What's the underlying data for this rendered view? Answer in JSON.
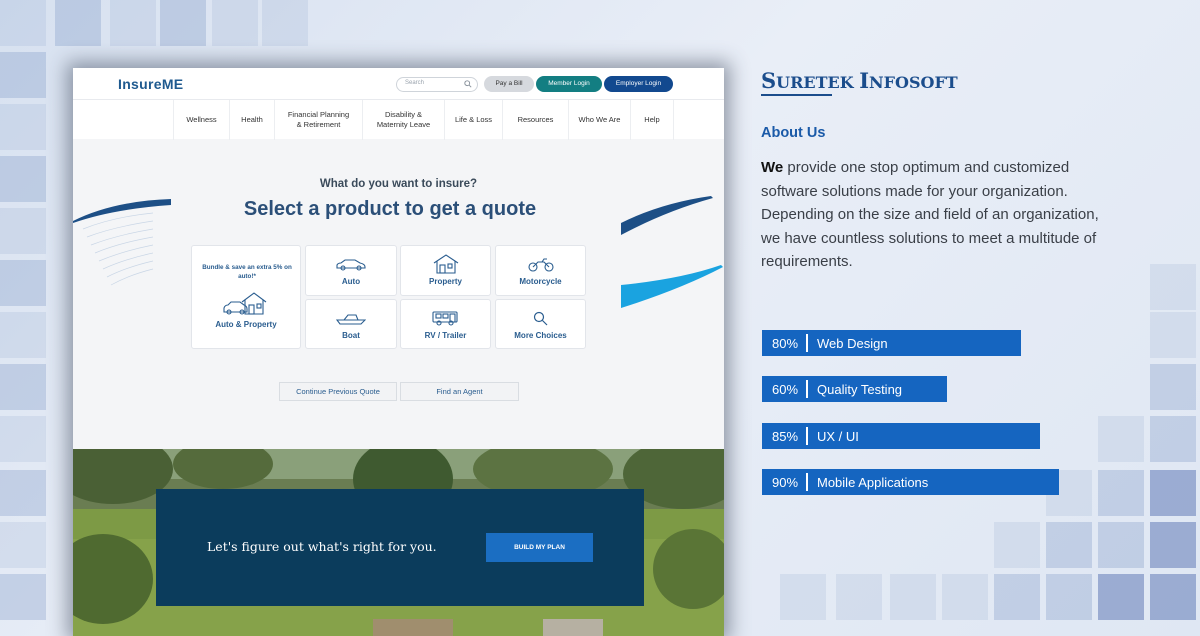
{
  "mockup": {
    "logo": "InsureME",
    "search_placeholder": "Search",
    "pay_bill": "Pay a Bill",
    "member_login": "Member Login",
    "employer_login": "Employer Login",
    "nav": [
      "Wellness",
      "Health",
      "Financial Planning\n& Retirement",
      "Disability &\nMaternity Leave",
      "Life & Loss",
      "Resources",
      "Who We Are",
      "Help"
    ],
    "question": "What do you want to insure?",
    "headline": "Select a product to get a quote",
    "bundle_text": "Bundle & save an extra 5% on auto!*",
    "products": {
      "auto_property": "Auto & Property",
      "auto": "Auto",
      "property": "Property",
      "motorcycle": "Motorcycle",
      "boat": "Boat",
      "rv": "RV / Trailer",
      "more": "More Choices"
    },
    "continue_quote": "Continue Previous Quote",
    "find_agent": "Find an Agent",
    "cta_text": "Let's figure out what's right for you.",
    "cta_button": "BUILD MY PLAN"
  },
  "panel": {
    "brand_first": "S",
    "brand_rest1": "URETEK ",
    "brand_i": "I",
    "brand_rest2": "NFOSOFT",
    "about_heading": "About Us",
    "about_first_word": "We",
    "about_body": " provide one stop optimum and customized software solutions made for your organization. Depending on the size and field of an organization, we have countless solutions to meet a multitude of requirements.",
    "skills": [
      {
        "percent": "80%",
        "label": "Web Design",
        "value": 80
      },
      {
        "percent": "60%",
        "label": "Quality Testing",
        "value": 60
      },
      {
        "percent": "85%",
        "label": "UX / UI",
        "value": 85
      },
      {
        "percent": "90%",
        "label": "Mobile Applications",
        "value": 90
      }
    ]
  },
  "colors": {
    "accent": "#1565c0",
    "navy": "#0b3c5c",
    "teal": "#137e82",
    "brand": "#1b4d8c"
  }
}
